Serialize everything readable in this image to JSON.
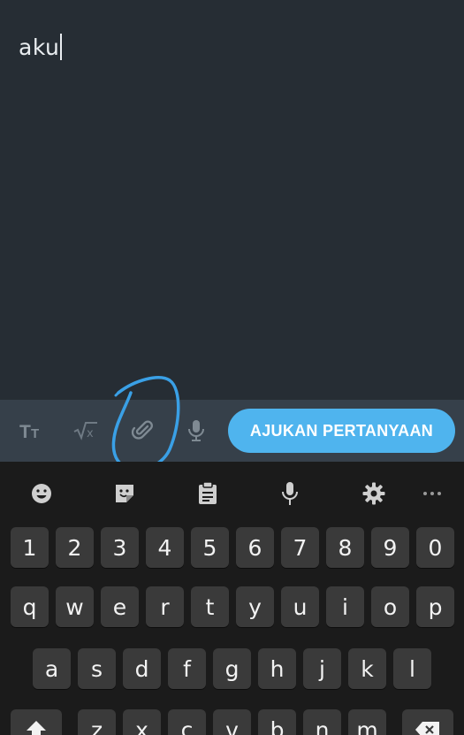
{
  "editor": {
    "text": "aku"
  },
  "toolbar": {
    "text_format_icon": "text-size-icon",
    "math_icon": "square-root-icon",
    "attach_icon": "paperclip-icon",
    "mic_icon": "microphone-icon",
    "submit_label": "AJUKAN PERTANYAAN",
    "submit_color": "#4fb4ee",
    "annotation_color": "#3aa0e6"
  },
  "keyboard_toolbar": {
    "icons": [
      "emoji-icon",
      "sticker-icon",
      "clipboard-icon",
      "microphone-icon",
      "settings-icon",
      "more-icon"
    ]
  },
  "keyboard": {
    "row_numbers": [
      "1",
      "2",
      "3",
      "4",
      "5",
      "6",
      "7",
      "8",
      "9",
      "0"
    ],
    "row_top": [
      "q",
      "w",
      "e",
      "r",
      "t",
      "y",
      "u",
      "i",
      "o",
      "p"
    ],
    "row_middle": [
      "a",
      "s",
      "d",
      "f",
      "g",
      "h",
      "j",
      "k",
      "l"
    ],
    "row_bottom": [
      "z",
      "x",
      "c",
      "v",
      "b",
      "n",
      "m"
    ],
    "shift_icon": "shift-icon",
    "backspace_icon": "backspace-icon"
  }
}
